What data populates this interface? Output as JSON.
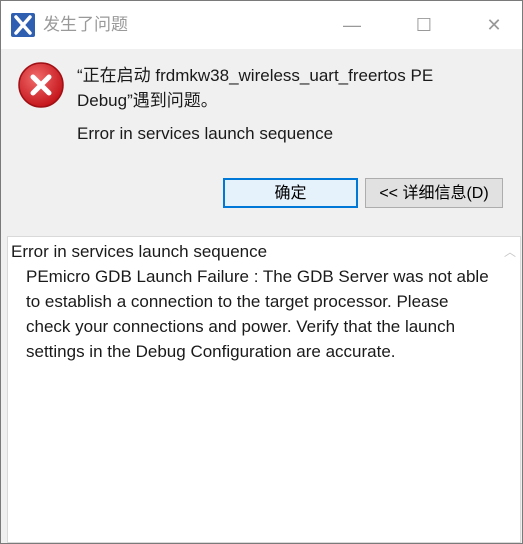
{
  "window": {
    "title": "发生了问题",
    "controls": {
      "minimize": "—",
      "maximize": "☐",
      "close": "✕"
    }
  },
  "icons": {
    "app": "eclipse-x-icon",
    "error": "error-x-circle-icon",
    "error_color": "#d32f2f"
  },
  "message": {
    "line1": "“正在启动 frdmkw38_wireless_uart_freertos PE Debug”遇到问题。",
    "summary": "Error in services launch sequence"
  },
  "buttons": {
    "ok": "确定",
    "details": "<< 详细信息(D)"
  },
  "details": {
    "heading": "Error in services launch sequence",
    "body": "PEmicro GDB Launch Failure : The GDB Server was not able to establish a connection to the target processor. Please check your connections and power. Verify that the launch settings in the Debug Configuration are accurate."
  },
  "scrollbar": {
    "up_arrow": "︿"
  }
}
